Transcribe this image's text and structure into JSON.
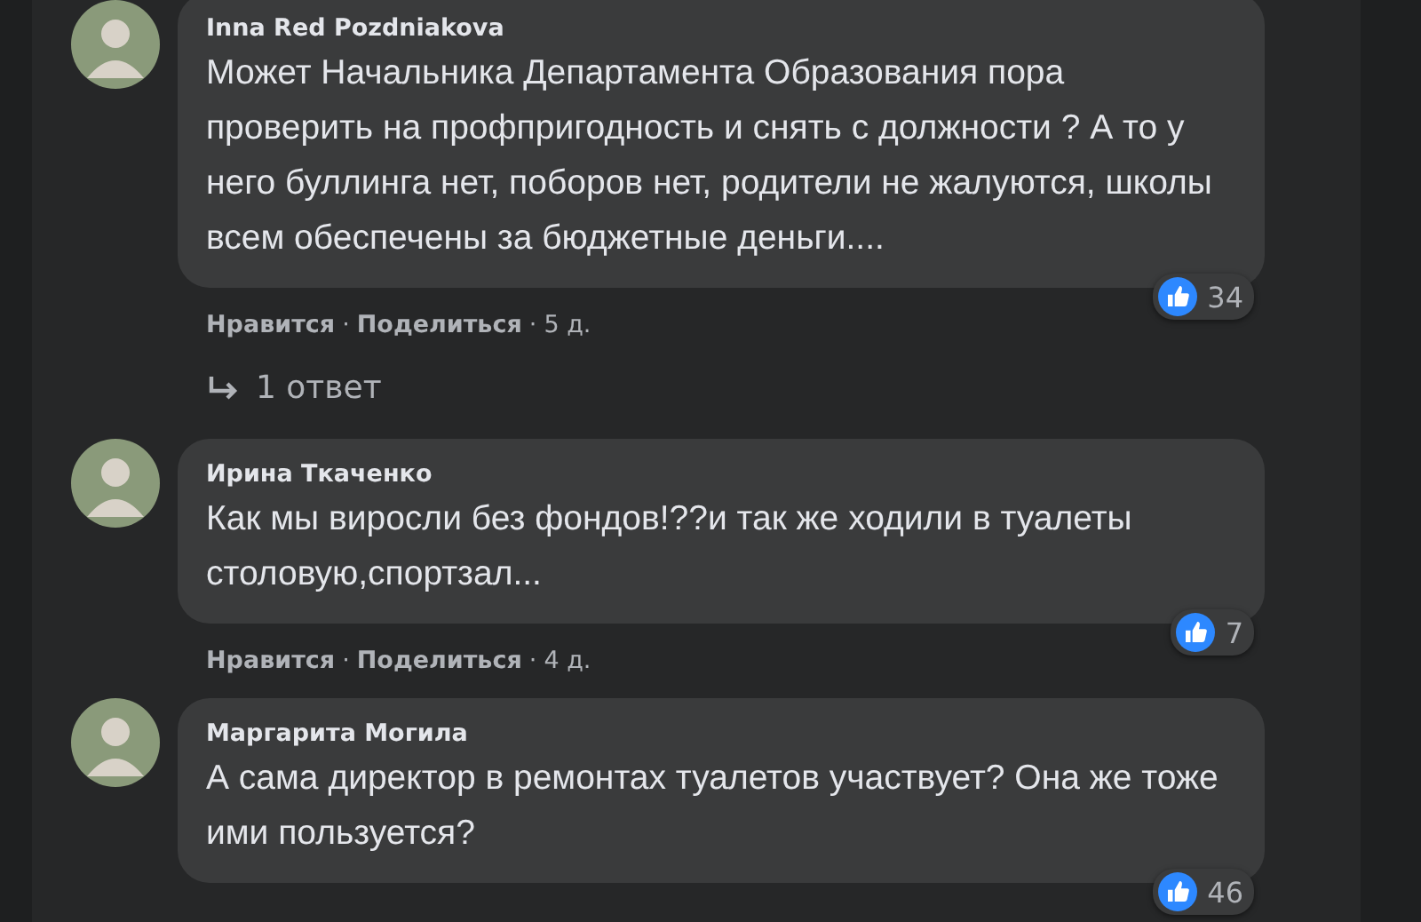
{
  "separator": "·",
  "comments": [
    {
      "author": "Inna Red Pozdniakova",
      "text": "Может Начальника Департамента Образования пора проверить на профпригодность и снять с должности ? А то у него буллинга нет, поборов нет, родители не жалуются, школы всем обеспечены за бюджетные деньги....",
      "actions": [
        "Нравится",
        "Поделиться",
        "5 д."
      ],
      "likes": "34",
      "replies": "1 ответ"
    },
    {
      "author": "Ирина Ткаченко",
      "text": "Как мы виросли без фондов!??и так же ходили в туалеты столовую,спортзал...",
      "actions": [
        "Нравится",
        "Поделиться",
        "4 д."
      ],
      "likes": "7"
    },
    {
      "author": "Маргарита Могила",
      "text": "А сама директор в ремонтах туалетов участвует? Она же тоже ими пользуется?",
      "likes": "46"
    }
  ]
}
